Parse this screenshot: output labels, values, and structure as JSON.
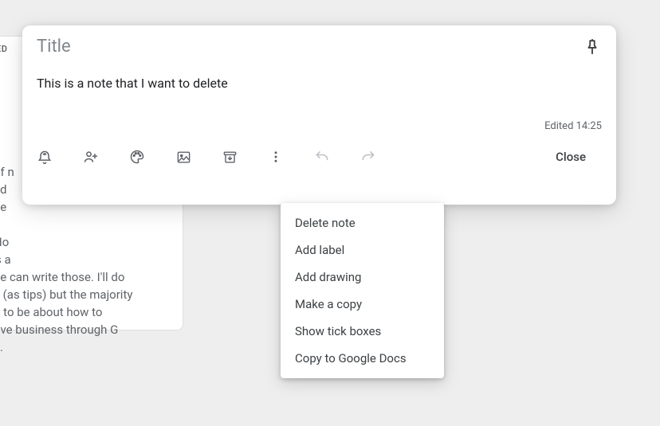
{
  "note": {
    "title_placeholder": "Title",
    "body": "This is a note that I want to delete",
    "edited_text": "Edited 14:25",
    "close_label": "Close"
  },
  "menu": {
    "items": [
      "Delete note",
      "Add label",
      "Add drawing",
      "Make a copy",
      "Show tick boxes",
      "Copy to Google Docs"
    ],
    "highlighted_index": 0
  },
  "background": {
    "badge": "ED",
    "text_fragments": [
      "of n",
      "ed",
      "he",
      "Ho",
      "'s a",
      "ne can write those. I'll do",
      "e (as tips) but the majority",
      "d to be about how to",
      "ove business through G",
      "e."
    ]
  }
}
